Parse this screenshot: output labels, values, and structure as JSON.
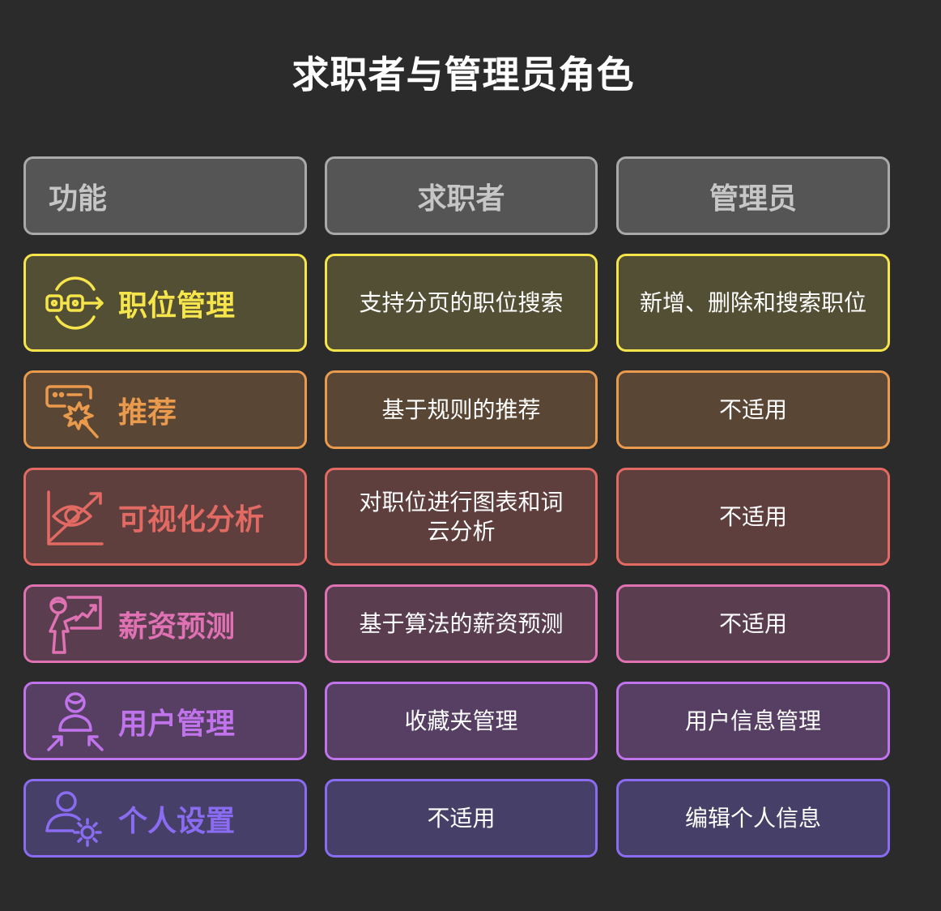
{
  "title": "求职者与管理员角色",
  "headers": [
    "功能",
    "求职者",
    "管理员"
  ],
  "rows": [
    {
      "feature": "职位管理",
      "icon": "glasses-arrow-icon",
      "color": "#f6e44b",
      "jobseeker": "支持分页的职位搜索",
      "admin": "新增、删除和搜索职位"
    },
    {
      "feature": "推荐",
      "icon": "click-burst-icon",
      "color": "#ea9a4d",
      "jobseeker": "基于规则的推荐",
      "admin": "不适用"
    },
    {
      "feature": "可视化分析",
      "icon": "eye-chart-icon",
      "color": "#e26a63",
      "jobseeker": "对职位进行图表和词云分析",
      "admin": "不适用"
    },
    {
      "feature": "薪资预测",
      "icon": "presenter-chart-icon",
      "color": "#e072b4",
      "jobseeker": "基于算法的薪资预测",
      "admin": "不适用"
    },
    {
      "feature": "用户管理",
      "icon": "user-arrows-icon",
      "color": "#c173ec",
      "jobseeker": "收藏夹管理",
      "admin": "用户信息管理"
    },
    {
      "feature": "个人设置",
      "icon": "user-gear-icon",
      "color": "#8a6cf2",
      "jobseeker": "不适用",
      "admin": "编辑个人信息"
    }
  ]
}
